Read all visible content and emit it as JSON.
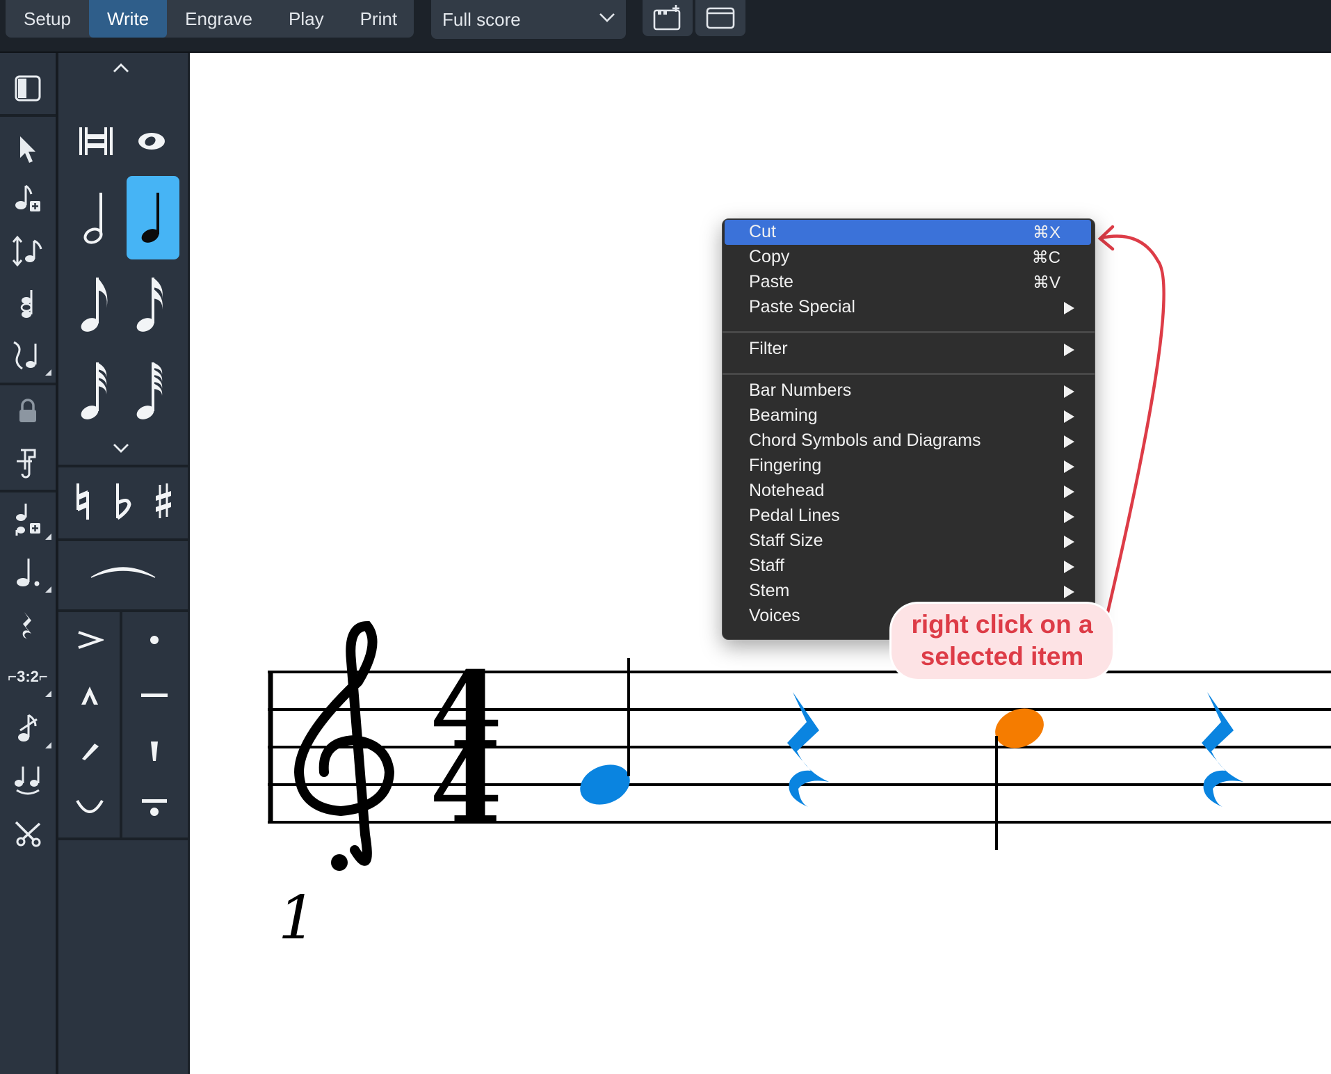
{
  "top_bar": {
    "tabs": [
      {
        "label": "Setup",
        "active": false
      },
      {
        "label": "Write",
        "active": true
      },
      {
        "label": "Engrave",
        "active": false
      },
      {
        "label": "Play",
        "active": false
      },
      {
        "label": "Print",
        "active": false
      }
    ],
    "layout_selector": {
      "value": "Full score",
      "icon": "chevron-down-icon"
    },
    "buttons": [
      {
        "name": "add-tab-icon"
      },
      {
        "name": "window-icon"
      }
    ]
  },
  "toolbox": {
    "items": [
      "panel-toggle-icon",
      "select-arrow-icon",
      "note-input-icon",
      "insert-mode-icon",
      "chord-mode-icon",
      "grace-notes-icon",
      "lock-duration-icon",
      "force-duration-icon",
      "add-note-icon",
      "dotted-note-icon",
      "rest-icon",
      "tuplet-icon",
      "grace-note-icon",
      "tie-icon",
      "scissors-icon"
    ],
    "tuplet_label": "⌐3:2⌐"
  },
  "notes_panel": {
    "durations": [
      "breve",
      "whole",
      "half",
      "quarter",
      "eighth",
      "sixteenth",
      "thirty-second",
      "sixty-fourth"
    ],
    "selected_duration": "quarter",
    "accidentals": [
      "natural",
      "flat",
      "sharp"
    ],
    "articulations": [
      "accent",
      "staccato",
      "marcato",
      "tenuto",
      "staccatissimo",
      "stress",
      "unstress",
      "staccato-tenuto"
    ]
  },
  "score": {
    "clef": "treble",
    "time_signature": {
      "numerator": "4",
      "denominator": "4"
    },
    "bar_number": "1",
    "selection_color": "#0a84e0",
    "highlight_color": "#f57c00"
  },
  "context_menu": {
    "highlight_color": "#3b72d9",
    "groups": [
      [
        {
          "label": "Cut",
          "shortcut": "⌘X",
          "submenu": false,
          "highlighted": true
        },
        {
          "label": "Copy",
          "shortcut": "⌘C",
          "submenu": false
        },
        {
          "label": "Paste",
          "shortcut": "⌘V",
          "submenu": false
        },
        {
          "label": "Paste Special",
          "shortcut": "",
          "submenu": true
        }
      ],
      [
        {
          "label": "Filter",
          "shortcut": "",
          "submenu": true
        }
      ],
      [
        {
          "label": "Bar Numbers",
          "shortcut": "",
          "submenu": true
        },
        {
          "label": "Beaming",
          "shortcut": "",
          "submenu": true
        },
        {
          "label": "Chord Symbols and Diagrams",
          "shortcut": "",
          "submenu": true
        },
        {
          "label": "Fingering",
          "shortcut": "",
          "submenu": true
        },
        {
          "label": "Notehead",
          "shortcut": "",
          "submenu": true
        },
        {
          "label": "Pedal Lines",
          "shortcut": "",
          "submenu": true
        },
        {
          "label": "Staff Size",
          "shortcut": "",
          "submenu": true
        },
        {
          "label": "Staff",
          "shortcut": "",
          "submenu": true
        },
        {
          "label": "Stem",
          "shortcut": "",
          "submenu": true
        },
        {
          "label": "Voices",
          "shortcut": "",
          "submenu": true
        }
      ]
    ]
  },
  "annotation": {
    "line1": "right click on a",
    "line2": "selected item",
    "color": "#dd3c47"
  }
}
